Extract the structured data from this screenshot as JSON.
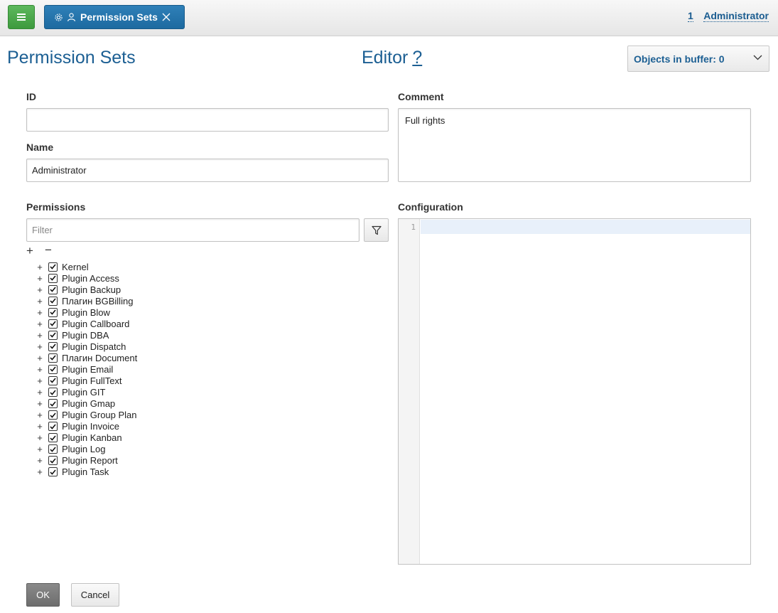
{
  "topbar": {
    "tab_label": "Permission Sets",
    "user_count": "1",
    "user_name": "Administrator"
  },
  "header": {
    "page_title": "Permission Sets",
    "editor_title": "Editor",
    "help": "?",
    "buffer_label": "Objects in buffer: 0"
  },
  "form": {
    "id_label": "ID",
    "id_value": "",
    "name_label": "Name",
    "name_value": "Administrator",
    "comment_label": "Comment",
    "comment_value": "Full rights",
    "permissions_label": "Permissions",
    "filter_placeholder": "Filter",
    "configuration_label": "Configuration",
    "line_number": "1"
  },
  "tree": {
    "expand_all": "+",
    "collapse_all": "−",
    "items": [
      {
        "label": "Kernel",
        "checked": true
      },
      {
        "label": "Plugin Access",
        "checked": true
      },
      {
        "label": "Plugin Backup",
        "checked": true
      },
      {
        "label": "Плагин BGBilling",
        "checked": true
      },
      {
        "label": "Plugin Blow",
        "checked": true
      },
      {
        "label": "Plugin Callboard",
        "checked": true
      },
      {
        "label": "Plugin DBA",
        "checked": true
      },
      {
        "label": "Plugin Dispatch",
        "checked": true
      },
      {
        "label": "Плагин Document",
        "checked": true
      },
      {
        "label": "Plugin Email",
        "checked": true
      },
      {
        "label": "Plugin FullText",
        "checked": true
      },
      {
        "label": "Plugin GIT",
        "checked": true
      },
      {
        "label": "Plugin Gmap",
        "checked": true
      },
      {
        "label": "Plugin Group Plan",
        "checked": true
      },
      {
        "label": "Plugin Invoice",
        "checked": true
      },
      {
        "label": "Plugin Kanban",
        "checked": true
      },
      {
        "label": "Plugin Log",
        "checked": true
      },
      {
        "label": "Plugin Report",
        "checked": true
      },
      {
        "label": "Plugin Task",
        "checked": true
      }
    ]
  },
  "buttons": {
    "ok": "OK",
    "cancel": "Cancel"
  },
  "colors": {
    "accent": "#1c5f93",
    "menu_green": "#4cae4c",
    "tab_blue": "#2472a8"
  }
}
